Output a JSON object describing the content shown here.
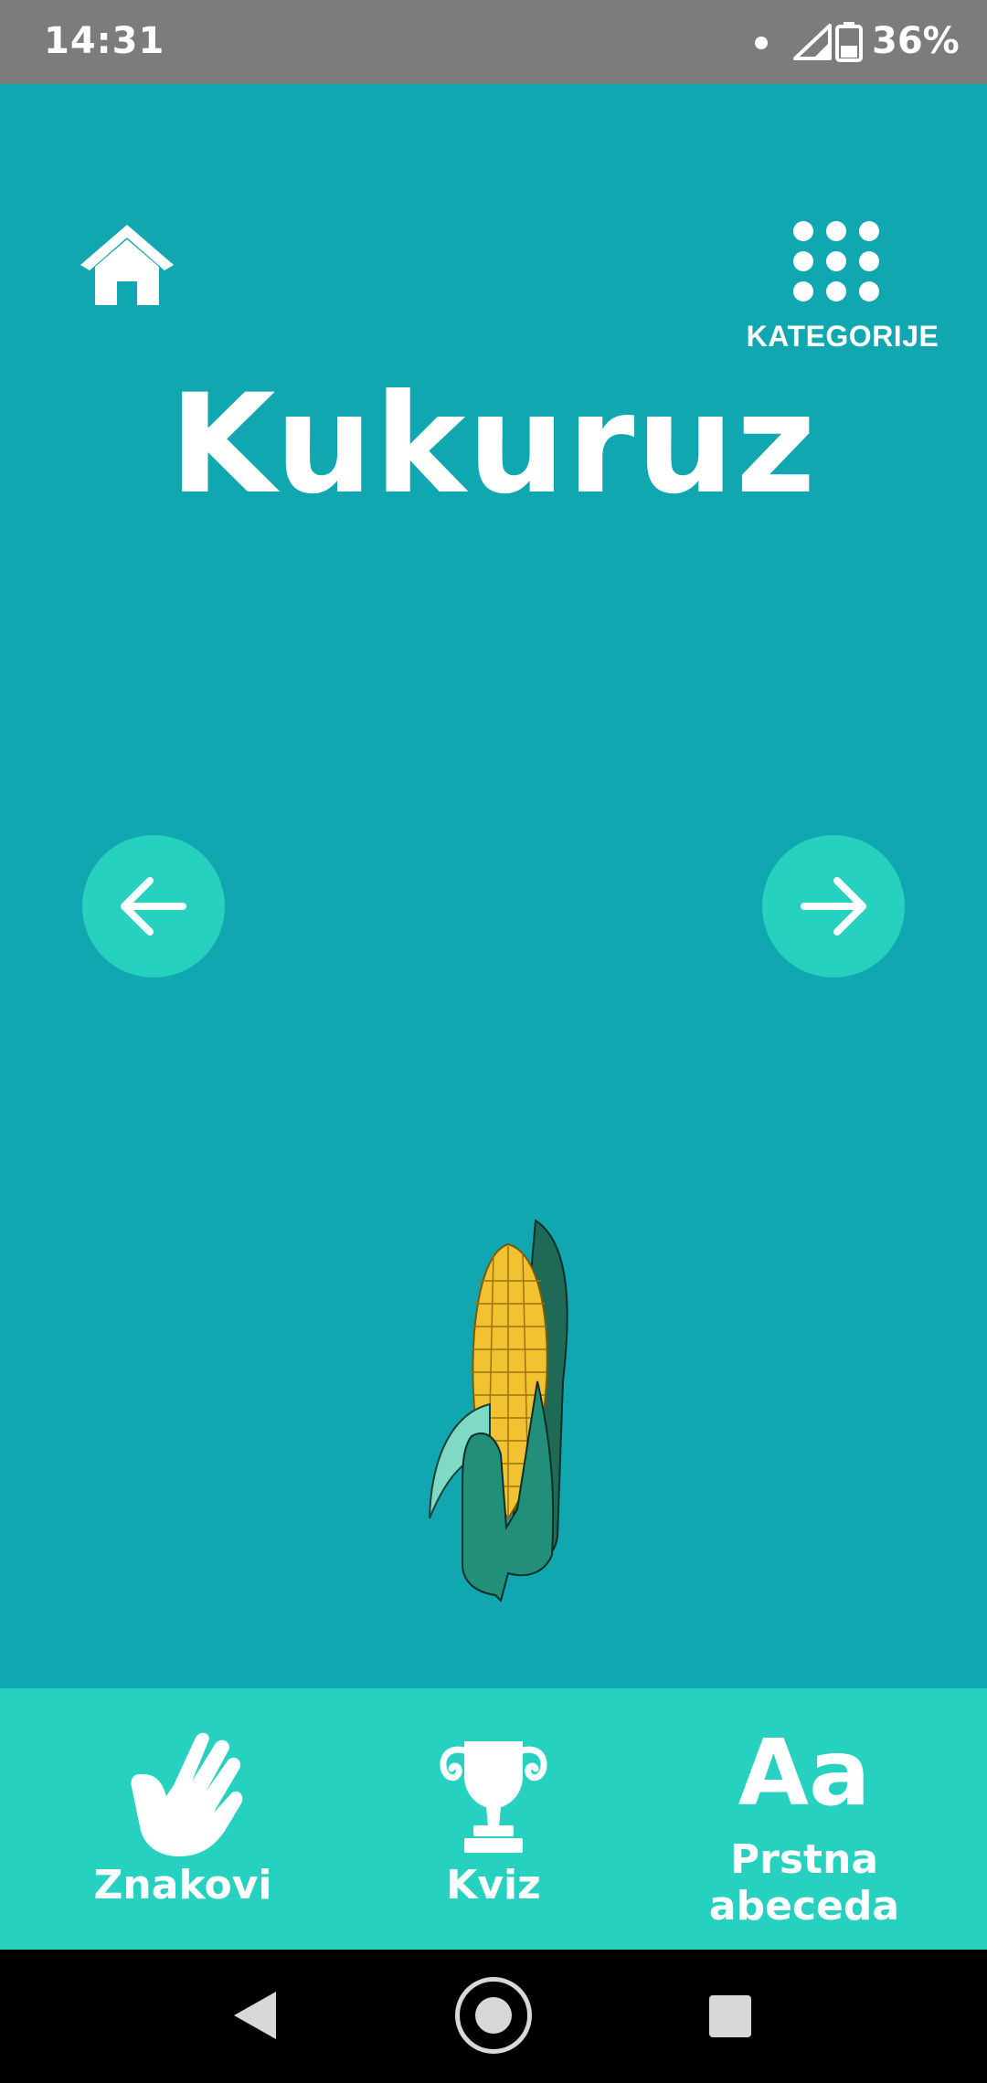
{
  "status_bar": {
    "time": "14:31",
    "battery_percent": "36%",
    "icons": [
      "notification-dot-icon",
      "signal-icon",
      "battery-icon"
    ]
  },
  "header": {
    "home_icon": "home-icon",
    "categories_icon": "grid-icon",
    "categories_label": "KATEGORIJE"
  },
  "word": {
    "title": "Kukuruz",
    "illustration": "corn-icon"
  },
  "navigation": {
    "prev_icon": "arrow-left-icon",
    "next_icon": "arrow-right-icon"
  },
  "tabs": [
    {
      "label": "Znakovi",
      "icon": "hand-icon"
    },
    {
      "label": "Kviz",
      "icon": "trophy-icon"
    },
    {
      "label": "Prstna abeceda",
      "icon_text": "Aa"
    }
  ],
  "system_nav": {
    "icons": [
      "back-icon",
      "home-circle-icon",
      "recents-icon"
    ]
  },
  "colors": {
    "background": "#10a7b0",
    "accent": "#27d1c0",
    "status_bar": "#7c7c7c"
  }
}
